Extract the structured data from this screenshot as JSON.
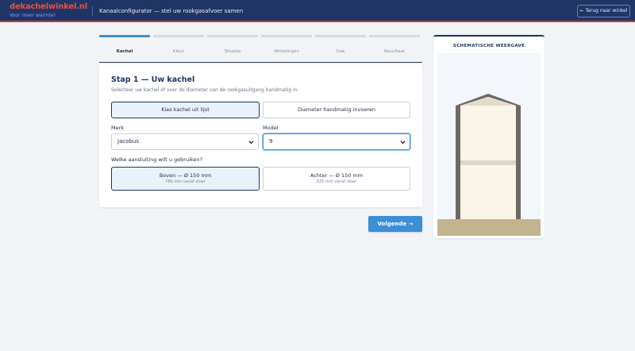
{
  "header": {
    "brand_name": "dekachelwinkel.nl",
    "brand_tagline": "Voor meer warmte!",
    "subtitle": "Kanaalconfigurator — stel uw rookgasafvoer samen",
    "back_label": "← Terug naar winkel"
  },
  "steps": [
    {
      "label": "Kachel",
      "active": true
    },
    {
      "label": "Kleur",
      "active": false
    },
    {
      "label": "Situatie",
      "active": false
    },
    {
      "label": "Afmetingen",
      "active": false
    },
    {
      "label": "Dak",
      "active": false
    },
    {
      "label": "Resultaat",
      "active": false
    }
  ],
  "card": {
    "title": "Stap 1 — Uw kachel",
    "intro": "Selecteer uw kachel of voer de diameter van de rookgasuitgang handmatig in.",
    "mode_options": [
      {
        "label": "Kies kachel uit lijst",
        "selected": true
      },
      {
        "label": "Diameter handmatig invoeren",
        "selected": false
      }
    ],
    "brand_label": "Merk",
    "brand_value": "Jacobus",
    "model_label": "Model",
    "model_value": "9",
    "connection_question": "Welke aansluiting wilt u gebruiken?",
    "connection_options": [
      {
        "title": "Boven — Ø 150 mm",
        "sub": "780 mm vanaf vloer",
        "selected": true
      },
      {
        "title": "Achter — Ø 150 mm",
        "sub": "625 mm vanaf vloer",
        "selected": false
      }
    ]
  },
  "next_label": "Volgende →",
  "schematic": {
    "title": "SCHEMATISCHE WEERGAVE"
  },
  "colors": {
    "navy": "#1f3566",
    "accent_blue": "#3a8fd6",
    "brand_red": "#e8523f",
    "wall": "#6e6a62",
    "floor": "#c2b48f",
    "interior": "#fbf4e9"
  }
}
